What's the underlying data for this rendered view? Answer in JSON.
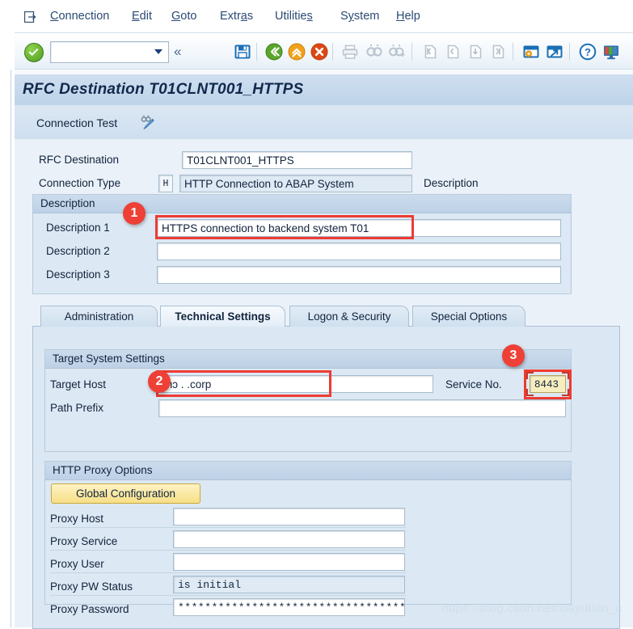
{
  "window": {
    "title": "RFC Destination T01CLNT001_HTTPS"
  },
  "menubar": {
    "system_icon": "system-menu-icon",
    "items": [
      {
        "label": "Connection",
        "mnemonic": "C"
      },
      {
        "label": "Edit",
        "mnemonic": "E"
      },
      {
        "label": "Goto",
        "mnemonic": "G"
      },
      {
        "label": "Extras",
        "mnemonic": "a"
      },
      {
        "label": "Utilities",
        "mnemonic": "s"
      },
      {
        "label": "System",
        "mnemonic": "y"
      },
      {
        "label": "Help",
        "mnemonic": "H"
      }
    ]
  },
  "toolbar": {
    "enter_icon": "green-check-enter-icon",
    "command_field_value": "",
    "command_field_placeholder": "",
    "dropdown_icon": "chevron-down-icon",
    "collapse_icon": "double-chevron-left-icon",
    "buttons": [
      {
        "name": "save-icon",
        "title": "Save"
      },
      {
        "name": "back-icon",
        "title": "Back"
      },
      {
        "name": "exit-icon",
        "title": "Exit"
      },
      {
        "name": "cancel-icon",
        "title": "Cancel"
      },
      {
        "name": "print-icon",
        "title": "Print"
      },
      {
        "name": "find-icon",
        "title": "Find"
      },
      {
        "name": "find-next-icon",
        "title": "Find Next"
      },
      {
        "name": "first-page-icon",
        "title": "First Page"
      },
      {
        "name": "previous-page-icon",
        "title": "Previous Page"
      },
      {
        "name": "next-page-icon",
        "title": "Next Page"
      },
      {
        "name": "last-page-icon",
        "title": "Last Page"
      },
      {
        "name": "create-session-icon",
        "title": "Create New Session"
      },
      {
        "name": "create-shortcut-icon",
        "title": "Create Shortcut"
      },
      {
        "name": "help-icon",
        "title": "Help"
      },
      {
        "name": "customize-local-layout-icon",
        "title": "Customize Local Layout"
      }
    ]
  },
  "apptoolbar": {
    "connection_test_label": "Connection Test",
    "connection_test_icon": "binoculars-pencil-icon"
  },
  "form": {
    "rfc_destination_label": "RFC Destination",
    "rfc_destination_value": "T01CLNT001_HTTPS",
    "connection_type_label": "Connection Type",
    "connection_type_code": "H",
    "connection_type_value": "HTTP Connection to ABAP System",
    "connection_type_suffix": "Description"
  },
  "description_group": {
    "title": "Description",
    "rows": [
      {
        "label": "Description 1",
        "value": "HTTPS connection to backend system T01"
      },
      {
        "label": "Description 2",
        "value": ""
      },
      {
        "label": "Description 3",
        "value": ""
      }
    ]
  },
  "tabs": [
    {
      "label": "Administration",
      "active": false
    },
    {
      "label": "Technical Settings",
      "active": true
    },
    {
      "label": "Logon & Security",
      "active": false
    },
    {
      "label": "Special Options",
      "active": false
    }
  ],
  "target_system_group": {
    "title": "Target System Settings",
    "target_host_label": "Target Host",
    "target_host_value": "mɔ                                 .  .corp",
    "service_no_label": "Service No.",
    "service_no_value": "8443",
    "path_prefix_label": "Path Prefix",
    "path_prefix_value": ""
  },
  "proxy_group": {
    "title": "HTTP Proxy Options",
    "global_config_button": "Global Configuration",
    "rows": [
      {
        "label": "Proxy Host",
        "value": "",
        "readonly": false,
        "mono": false
      },
      {
        "label": "Proxy Service",
        "value": "",
        "readonly": false,
        "mono": false
      },
      {
        "label": "Proxy User",
        "value": "",
        "readonly": false,
        "mono": false
      },
      {
        "label": "Proxy PW Status",
        "value": "is initial",
        "readonly": true,
        "mono": true
      },
      {
        "label": "Proxy Password",
        "value": "**********************************",
        "readonly": false,
        "mono": true
      }
    ]
  },
  "annotations": [
    {
      "id": "1",
      "target": "description-1-field"
    },
    {
      "id": "2",
      "target": "target-host-field"
    },
    {
      "id": "3",
      "target": "service-no-field"
    }
  ],
  "watermark": "https://blog.csdn.net/xiayutian_c",
  "colors": {
    "accent_red": "#ee4036",
    "title_band": "#c3d7ec",
    "canvas": "#eaf1f8",
    "group_bg": "#dce8f3",
    "yellow_button": "#f7df86",
    "focus_field": "#f7eec0"
  }
}
